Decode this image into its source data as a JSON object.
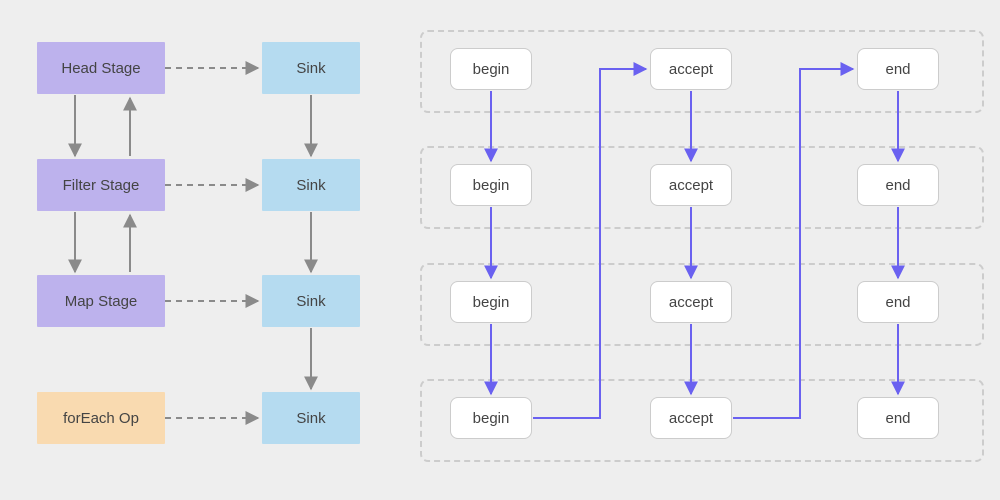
{
  "left": {
    "stages": [
      "Head Stage",
      "Filter Stage",
      "Map Stage"
    ],
    "terminal": "forEach Op",
    "sinks": [
      "Sink",
      "Sink",
      "Sink",
      "Sink"
    ]
  },
  "right": {
    "rows": 4,
    "cols": [
      "begin",
      "accept",
      "end"
    ]
  },
  "colors": {
    "purple": "#bdb2ed",
    "blue": "#b5dbf0",
    "orange": "#f9dab0",
    "arrowGray": "#8a8a8a",
    "arrowIndigo": "#6a61f0"
  }
}
